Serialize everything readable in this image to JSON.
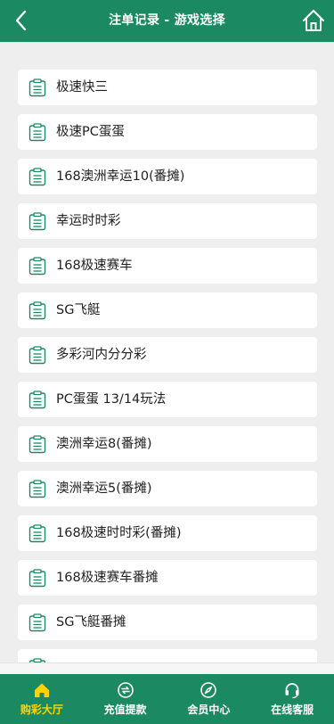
{
  "header": {
    "title": "注单记录 - 游戏选择"
  },
  "games": [
    {
      "label": "极速快三"
    },
    {
      "label": "极速PC蛋蛋"
    },
    {
      "label": "168澳洲幸运10(番摊)"
    },
    {
      "label": "幸运时时彩"
    },
    {
      "label": "168极速赛车"
    },
    {
      "label": "SG飞艇"
    },
    {
      "label": "多彩河内分分彩"
    },
    {
      "label": "PC蛋蛋 13/14玩法"
    },
    {
      "label": "澳洲幸运8(番摊)"
    },
    {
      "label": "澳洲幸运5(番摊)"
    },
    {
      "label": "168极速时时彩(番摊)"
    },
    {
      "label": "168极速赛车番摊"
    },
    {
      "label": "SG飞艇番摊"
    },
    {
      "label": ""
    }
  ],
  "tabbar": {
    "items": [
      {
        "label": "购彩大厅",
        "icon": "home-icon",
        "active": true
      },
      {
        "label": "充值提款",
        "icon": "exchange-icon",
        "active": false
      },
      {
        "label": "会员中心",
        "icon": "compass-icon",
        "active": false
      },
      {
        "label": "在线客服",
        "icon": "headset-icon",
        "active": false
      }
    ]
  },
  "colors": {
    "brand": "#1b8a63",
    "active_tab": "#ffd200",
    "background": "#eeeeee"
  }
}
